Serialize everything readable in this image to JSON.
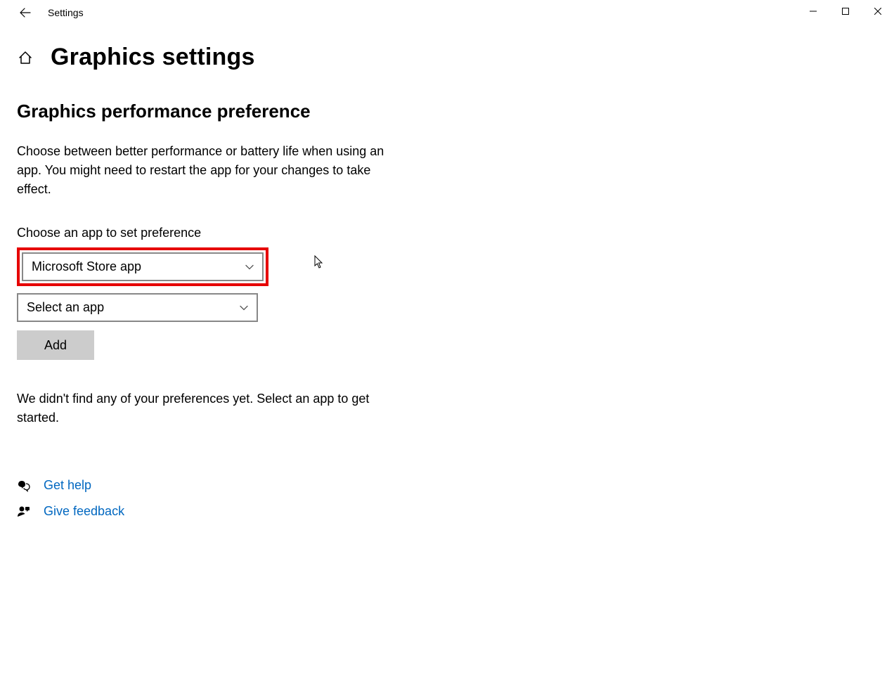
{
  "titlebar": {
    "app_name": "Settings"
  },
  "page": {
    "title": "Graphics settings"
  },
  "section": {
    "heading": "Graphics performance preference",
    "description": "Choose between better performance or battery life when using an app. You might need to restart the app for your changes to take effect.",
    "choose_label": "Choose an app to set preference",
    "dropdown_app_type": "Microsoft Store app",
    "dropdown_select_app": "Select an app",
    "add_button": "Add",
    "empty_state": "We didn't find any of your preferences yet. Select an app to get started."
  },
  "links": {
    "help": "Get help",
    "feedback": "Give feedback"
  },
  "highlight": {
    "color": "#e60000"
  }
}
